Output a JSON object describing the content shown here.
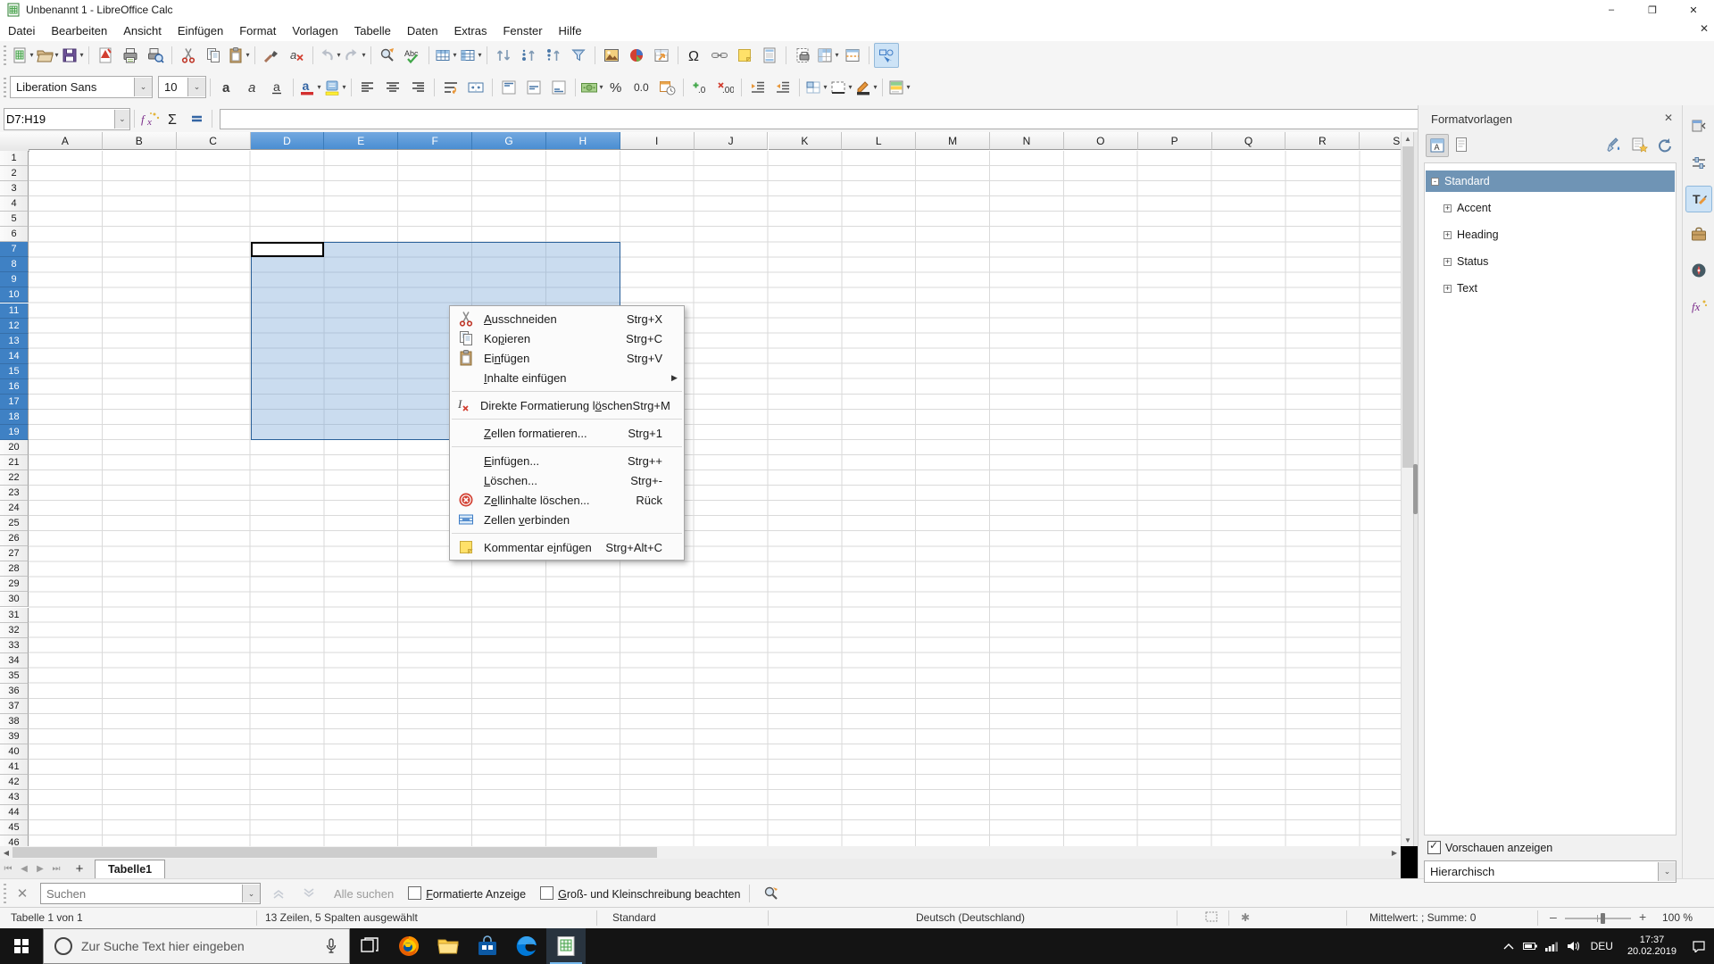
{
  "window": {
    "title": "Unbenannt 1 - LibreOffice Calc",
    "minimize": "–",
    "maximize": "❐",
    "close": "✕"
  },
  "menubar": {
    "items": [
      "Datei",
      "Bearbeiten",
      "Ansicht",
      "Einfügen",
      "Format",
      "Vorlagen",
      "Tabelle",
      "Daten",
      "Extras",
      "Fenster",
      "Hilfe"
    ],
    "close_document": "✕"
  },
  "toolbar_standard": [
    {
      "icon": "new",
      "dd": true
    },
    {
      "icon": "open",
      "dd": true
    },
    {
      "icon": "save",
      "dd": true
    },
    {
      "sep": true
    },
    {
      "icon": "export-pdf"
    },
    {
      "icon": "print"
    },
    {
      "icon": "print-preview"
    },
    {
      "sep": true
    },
    {
      "icon": "cut"
    },
    {
      "icon": "copy"
    },
    {
      "icon": "paste",
      "dd": true
    },
    {
      "sep": true
    },
    {
      "icon": "clone-formatting"
    },
    {
      "icon": "clear-formatting"
    },
    {
      "sep": true
    },
    {
      "icon": "undo",
      "dd": true
    },
    {
      "icon": "redo",
      "dd": true
    },
    {
      "sep": true
    },
    {
      "icon": "find-replace"
    },
    {
      "icon": "spelling"
    },
    {
      "sep": true
    },
    {
      "icon": "insert-row",
      "dd": true
    },
    {
      "icon": "insert-column",
      "dd": true
    },
    {
      "sep": true
    },
    {
      "icon": "sort"
    },
    {
      "icon": "sort-ascending"
    },
    {
      "icon": "sort-descending"
    },
    {
      "icon": "autofilter"
    },
    {
      "sep": true
    },
    {
      "icon": "insert-image"
    },
    {
      "icon": "insert-chart"
    },
    {
      "icon": "pivot-table"
    },
    {
      "sep": true
    },
    {
      "icon": "special-character"
    },
    {
      "icon": "hyperlink"
    },
    {
      "icon": "comment"
    },
    {
      "icon": "headers-footers"
    },
    {
      "sep": true
    },
    {
      "icon": "print-area"
    },
    {
      "icon": "freeze-rows-columns",
      "dd": true
    },
    {
      "icon": "split-window"
    },
    {
      "sep": true
    },
    {
      "icon": "show-draw-functions",
      "active": true
    }
  ],
  "toolbar_formatting": {
    "font_name": "Liberation Sans",
    "font_size": "10",
    "buttons": [
      {
        "icon": "bold"
      },
      {
        "icon": "italic"
      },
      {
        "icon": "underline"
      },
      {
        "sep": true
      },
      {
        "icon": "font-color",
        "dd": true
      },
      {
        "icon": "highlight-color",
        "dd": true
      },
      {
        "sep": true
      },
      {
        "icon": "align-left"
      },
      {
        "icon": "align-center"
      },
      {
        "icon": "align-right"
      },
      {
        "sep": true
      },
      {
        "icon": "wrap-text"
      },
      {
        "icon": "merge-cells"
      },
      {
        "sep": true
      },
      {
        "icon": "align-top"
      },
      {
        "icon": "align-middle"
      },
      {
        "icon": "align-bottom"
      },
      {
        "sep": true
      },
      {
        "icon": "format-currency",
        "dd": true
      },
      {
        "icon": "format-percent"
      },
      {
        "icon": "format-number"
      },
      {
        "icon": "format-date"
      },
      {
        "sep": true
      },
      {
        "icon": "add-decimal"
      },
      {
        "icon": "delete-decimal"
      },
      {
        "sep": true
      },
      {
        "icon": "increase-indent"
      },
      {
        "icon": "decrease-indent"
      },
      {
        "sep": true
      },
      {
        "icon": "borders",
        "dd": true
      },
      {
        "icon": "border-style",
        "dd": true
      },
      {
        "icon": "border-color",
        "dd": true
      },
      {
        "sep": true
      },
      {
        "icon": "conditional-formatting",
        "dd": true
      }
    ]
  },
  "formula_bar": {
    "name_box": "D7:H19",
    "input_value": "",
    "expand": "⌄"
  },
  "grid": {
    "columns": [
      "A",
      "B",
      "C",
      "D",
      "E",
      "F",
      "G",
      "H",
      "I",
      "J",
      "K",
      "L",
      "M",
      "N",
      "O",
      "P",
      "Q",
      "R",
      "S"
    ],
    "row_count": 46,
    "selected_columns": [
      "D",
      "E",
      "F",
      "G",
      "H"
    ],
    "selected_row_start": 7,
    "selected_row_end": 19,
    "active_cell": "D7",
    "selection_fill": "#cfe4f6",
    "selection_border": "#2a6099"
  },
  "context_menu": {
    "items": [
      {
        "icon": "cut",
        "label": "Ausschneiden",
        "accel": 0,
        "shortcut": "Strg+X"
      },
      {
        "icon": "copy",
        "label": "Kopieren",
        "accel": 2,
        "shortcut": "Strg+C"
      },
      {
        "icon": "paste",
        "label": "Einfügen",
        "accel": 2,
        "shortcut": "Strg+V"
      },
      {
        "icon": "",
        "label": "Inhalte einfügen",
        "accel": 0,
        "submenu": true,
        "sep_after": true
      },
      {
        "icon": "clear-direct-formatting",
        "label": "Direkte Formatierung löschen",
        "accel": 22,
        "shortcut": "Strg+M",
        "sep_after": true
      },
      {
        "icon": "",
        "label": "Zellen formatieren...",
        "accel": 0,
        "shortcut": "Strg+1",
        "sep_after": true
      },
      {
        "icon": "",
        "label": "Einfügen...",
        "accel": 0,
        "shortcut": "Strg++"
      },
      {
        "icon": "",
        "label": "Löschen...",
        "accel": 0,
        "shortcut": "Strg+-"
      },
      {
        "icon": "delete-contents",
        "label": "Zellinhalte löschen...",
        "accel": 1,
        "shortcut": "Rück"
      },
      {
        "icon": "merge-cells-menu",
        "label": "Zellen verbinden",
        "accel": 7,
        "sep_after": true
      },
      {
        "icon": "comment",
        "label": "Kommentar einfügen",
        "accel": 11,
        "shortcut": "Strg+Alt+C"
      }
    ]
  },
  "sheet_bar": {
    "add_label": "+",
    "tabs": [
      {
        "label": "Tabelle1",
        "active": true
      }
    ]
  },
  "find_bar": {
    "placeholder": "Suchen",
    "all_label": "Alle suchen",
    "checkbox1": "Formatierte Anzeige",
    "checkbox1_accel": 0,
    "checkbox2": "Groß- und Kleinschreibung beachten",
    "checkbox2_accel": 0
  },
  "status_bar": {
    "sheet_info": "Tabelle 1 von 1",
    "selection_info": "13 Zeilen, 5 Spalten ausgewählt",
    "page_style": "Standard",
    "language": "Deutsch (Deutschland)",
    "summary": "Mittelwert: ; Summe: 0",
    "zoom_minus": "–",
    "zoom_plus": "+",
    "zoom_percent": "100 %"
  },
  "sidebar": {
    "title": "Formatvorlagen",
    "close": "✕",
    "tools_left": [
      "cell-styles",
      "page-styles"
    ],
    "tools_right": [
      "fill-format-mode",
      "new-style-from-selection",
      "update-style"
    ],
    "styles": [
      {
        "label": "Standard",
        "selected": true,
        "expand": "-",
        "level": 0
      },
      {
        "label": "Accent",
        "expand": "+",
        "level": 1
      },
      {
        "label": "Heading",
        "expand": "+",
        "level": 1
      },
      {
        "label": "Status",
        "expand": "+",
        "level": 1
      },
      {
        "label": "Text",
        "expand": "+",
        "level": 1
      }
    ],
    "preview_label": "Vorschauen anzeigen",
    "view_value": "Hierarchisch",
    "deck_tabs": [
      {
        "icon": "sidebar-settings"
      },
      {
        "icon": "properties"
      },
      {
        "icon": "styles",
        "active": true
      },
      {
        "icon": "gallery"
      },
      {
        "icon": "navigator"
      },
      {
        "icon": "functions"
      }
    ]
  },
  "taskbar": {
    "search_placeholder": "Zur Suche Text hier eingeben",
    "apps": [
      {
        "icon": "task-view"
      },
      {
        "icon": "firefox"
      },
      {
        "icon": "file-explorer"
      },
      {
        "icon": "store"
      },
      {
        "icon": "edge"
      },
      {
        "icon": "calc",
        "active": true
      }
    ],
    "tray_language": "DEU",
    "time": "17:37",
    "date": "20.02.2019"
  }
}
